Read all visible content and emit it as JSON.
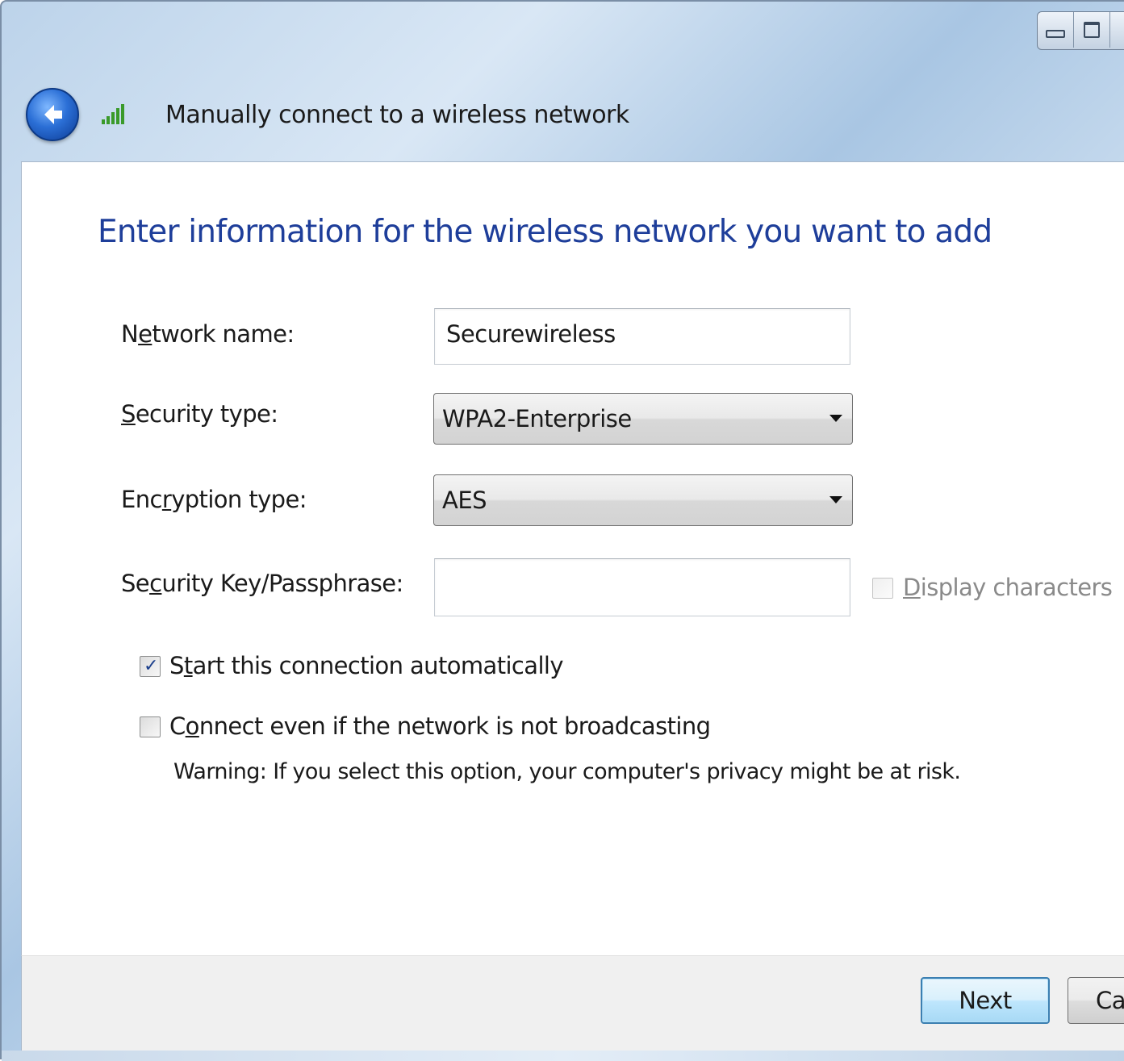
{
  "window": {
    "title": "Manually connect to a wireless network",
    "controls": [
      "minimize-icon",
      "maximize-icon"
    ]
  },
  "main": {
    "instruction": "Enter information for the wireless network you want to add",
    "network_name": {
      "label_before": "N",
      "label_accel": "e",
      "label_after": "twork name:",
      "value": "Securewireless"
    },
    "security_type": {
      "label_before": "",
      "label_accel": "S",
      "label_after": "ecurity type:",
      "selected": "WPA2-Enterprise"
    },
    "encryption_type": {
      "label_before": "Enc",
      "label_accel": "r",
      "label_after": "yption type:",
      "selected": "AES"
    },
    "security_key": {
      "label_before": "Se",
      "label_accel": "c",
      "label_after": "urity Key/Passphrase:",
      "value": ""
    },
    "display_characters": {
      "label_accel": "D",
      "label_after": "isplay characters",
      "checked": false,
      "enabled": false
    },
    "start_automatically": {
      "label_before": "S",
      "label_accel": "t",
      "label_after": "art this connection automatically",
      "checked": true
    },
    "connect_hidden": {
      "label_before": "C",
      "label_accel": "o",
      "label_after": "nnect even if the network is not broadcasting",
      "checked": false
    },
    "warning": "Warning: If you select this option, your computer's privacy might be at risk."
  },
  "footer": {
    "next_label": "Next",
    "cancel_label": "Ca"
  },
  "colors": {
    "instruction_blue": "#1e3e9a",
    "check_mark": "#1b3f8c",
    "default_button_border": "#3c7fb1"
  }
}
